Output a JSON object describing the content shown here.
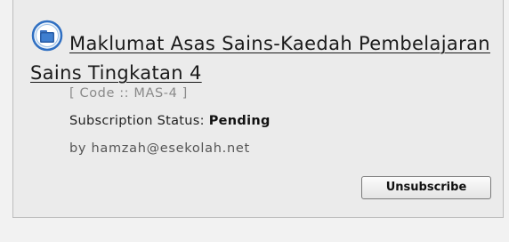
{
  "course": {
    "icon": "course-folder-icon",
    "title": "Maklumat Asas Sains-Kaedah Pembelajaran Sains Tingkatan 4",
    "code_text": "[ Code :: MAS-4 ]",
    "status_label": "Subscription Status:",
    "status_value": "Pending",
    "author": "by hamzah@esekolah.net"
  },
  "actions": {
    "unsubscribe_label": "Unsubscribe"
  },
  "colors": {
    "panel_background": "#ebebeb",
    "icon_ring": "#2f6fc2",
    "icon_folder": "#2a5ea6"
  }
}
